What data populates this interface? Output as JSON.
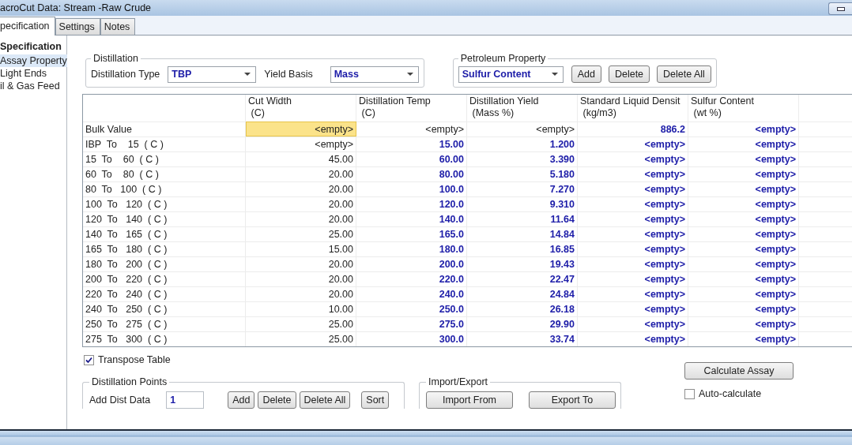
{
  "window": {
    "title": "acroCut Data: Stream -Raw Crude"
  },
  "tabs": [
    {
      "label": "pecification",
      "selected": true
    },
    {
      "label": "Settings",
      "selected": false
    },
    {
      "label": "Notes",
      "selected": false
    }
  ],
  "sidebar": {
    "heading": "Specification",
    "items": [
      {
        "label": "Assay Property",
        "selected": true
      },
      {
        "label": "Light Ends",
        "selected": false
      },
      {
        "label": "il & Gas Feed",
        "selected": false
      }
    ]
  },
  "distillation": {
    "title": "Distillation",
    "type_label": "Distillation Type",
    "type_value": "TBP",
    "basis_label": "Yield Basis",
    "basis_value": "Mass"
  },
  "petroleum_property": {
    "title": "Petroleum Property",
    "value": "Sulfur Content",
    "buttons": [
      "Add",
      "Delete",
      "Delete All"
    ]
  },
  "table": {
    "columns": [
      {
        "name": "Cut Width",
        "unit": "(C)"
      },
      {
        "name": "Distillation Temp",
        "unit": "(C)"
      },
      {
        "name": "Distillation Yield",
        "unit": "(Mass %)"
      },
      {
        "name": "Standard Liquid Densit",
        "unit": "(kg/m3)"
      },
      {
        "name": "Sulfur Content",
        "unit": "(wt %)"
      }
    ],
    "rows": [
      {
        "label": "Bulk Value",
        "cells": [
          {
            "text": "<empty>",
            "bold": false,
            "selected": true
          },
          {
            "text": "<empty>",
            "bold": false,
            "selected": false
          },
          {
            "text": "<empty>",
            "bold": false,
            "selected": false
          },
          {
            "text": "886.2",
            "bold": true,
            "selected": false
          },
          {
            "text": "<empty>",
            "bold": true,
            "selected": false
          }
        ]
      },
      {
        "label": "IBP  To    15  ( C )",
        "cells": [
          {
            "text": "<empty>",
            "bold": false,
            "selected": false
          },
          {
            "text": "15.00",
            "bold": true,
            "selected": false
          },
          {
            "text": "1.200",
            "bold": true,
            "selected": false
          },
          {
            "text": "<empty>",
            "bold": true,
            "selected": false
          },
          {
            "text": "<empty>",
            "bold": true,
            "selected": false
          }
        ]
      },
      {
        "label": "15  To    60  ( C )",
        "cells": [
          {
            "text": "45.00",
            "bold": false,
            "selected": false
          },
          {
            "text": "60.00",
            "bold": true,
            "selected": false
          },
          {
            "text": "3.390",
            "bold": true,
            "selected": false
          },
          {
            "text": "<empty>",
            "bold": true,
            "selected": false
          },
          {
            "text": "<empty>",
            "bold": true,
            "selected": false
          }
        ]
      },
      {
        "label": "60  To    80  ( C )",
        "cells": [
          {
            "text": "20.00",
            "bold": false,
            "selected": false
          },
          {
            "text": "80.00",
            "bold": true,
            "selected": false
          },
          {
            "text": "5.180",
            "bold": true,
            "selected": false
          },
          {
            "text": "<empty>",
            "bold": true,
            "selected": false
          },
          {
            "text": "<empty>",
            "bold": true,
            "selected": false
          }
        ]
      },
      {
        "label": "80  To   100  ( C )",
        "cells": [
          {
            "text": "20.00",
            "bold": false,
            "selected": false
          },
          {
            "text": "100.0",
            "bold": true,
            "selected": false
          },
          {
            "text": "7.270",
            "bold": true,
            "selected": false
          },
          {
            "text": "<empty>",
            "bold": true,
            "selected": false
          },
          {
            "text": "<empty>",
            "bold": true,
            "selected": false
          }
        ]
      },
      {
        "label": "100  To   120  ( C )",
        "cells": [
          {
            "text": "20.00",
            "bold": false,
            "selected": false
          },
          {
            "text": "120.0",
            "bold": true,
            "selected": false
          },
          {
            "text": "9.310",
            "bold": true,
            "selected": false
          },
          {
            "text": "<empty>",
            "bold": true,
            "selected": false
          },
          {
            "text": "<empty>",
            "bold": true,
            "selected": false
          }
        ]
      },
      {
        "label": "120  To   140  ( C )",
        "cells": [
          {
            "text": "20.00",
            "bold": false,
            "selected": false
          },
          {
            "text": "140.0",
            "bold": true,
            "selected": false
          },
          {
            "text": "11.64",
            "bold": true,
            "selected": false
          },
          {
            "text": "<empty>",
            "bold": true,
            "selected": false
          },
          {
            "text": "<empty>",
            "bold": true,
            "selected": false
          }
        ]
      },
      {
        "label": "140  To   165  ( C )",
        "cells": [
          {
            "text": "25.00",
            "bold": false,
            "selected": false
          },
          {
            "text": "165.0",
            "bold": true,
            "selected": false
          },
          {
            "text": "14.84",
            "bold": true,
            "selected": false
          },
          {
            "text": "<empty>",
            "bold": true,
            "selected": false
          },
          {
            "text": "<empty>",
            "bold": true,
            "selected": false
          }
        ]
      },
      {
        "label": "165  To   180  ( C )",
        "cells": [
          {
            "text": "15.00",
            "bold": false,
            "selected": false
          },
          {
            "text": "180.0",
            "bold": true,
            "selected": false
          },
          {
            "text": "16.85",
            "bold": true,
            "selected": false
          },
          {
            "text": "<empty>",
            "bold": true,
            "selected": false
          },
          {
            "text": "<empty>",
            "bold": true,
            "selected": false
          }
        ]
      },
      {
        "label": "180  To   200  ( C )",
        "cells": [
          {
            "text": "20.00",
            "bold": false,
            "selected": false
          },
          {
            "text": "200.0",
            "bold": true,
            "selected": false
          },
          {
            "text": "19.43",
            "bold": true,
            "selected": false
          },
          {
            "text": "<empty>",
            "bold": true,
            "selected": false
          },
          {
            "text": "<empty>",
            "bold": true,
            "selected": false
          }
        ]
      },
      {
        "label": "200  To   220  ( C )",
        "cells": [
          {
            "text": "20.00",
            "bold": false,
            "selected": false
          },
          {
            "text": "220.0",
            "bold": true,
            "selected": false
          },
          {
            "text": "22.47",
            "bold": true,
            "selected": false
          },
          {
            "text": "<empty>",
            "bold": true,
            "selected": false
          },
          {
            "text": "<empty>",
            "bold": true,
            "selected": false
          }
        ]
      },
      {
        "label": "220  To   240  ( C )",
        "cells": [
          {
            "text": "20.00",
            "bold": false,
            "selected": false
          },
          {
            "text": "240.0",
            "bold": true,
            "selected": false
          },
          {
            "text": "24.84",
            "bold": true,
            "selected": false
          },
          {
            "text": "<empty>",
            "bold": true,
            "selected": false
          },
          {
            "text": "<empty>",
            "bold": true,
            "selected": false
          }
        ]
      },
      {
        "label": "240  To   250  ( C )",
        "cells": [
          {
            "text": "10.00",
            "bold": false,
            "selected": false
          },
          {
            "text": "250.0",
            "bold": true,
            "selected": false
          },
          {
            "text": "26.18",
            "bold": true,
            "selected": false
          },
          {
            "text": "<empty>",
            "bold": true,
            "selected": false
          },
          {
            "text": "<empty>",
            "bold": true,
            "selected": false
          }
        ]
      },
      {
        "label": "250  To   275  ( C )",
        "cells": [
          {
            "text": "25.00",
            "bold": false,
            "selected": false
          },
          {
            "text": "275.0",
            "bold": true,
            "selected": false
          },
          {
            "text": "29.90",
            "bold": true,
            "selected": false
          },
          {
            "text": "<empty>",
            "bold": true,
            "selected": false
          },
          {
            "text": "<empty>",
            "bold": true,
            "selected": false
          }
        ]
      },
      {
        "label": "275  To   300  ( C )",
        "cells": [
          {
            "text": "25.00",
            "bold": false,
            "selected": false
          },
          {
            "text": "300.0",
            "bold": true,
            "selected": false
          },
          {
            "text": "33.74",
            "bold": true,
            "selected": false
          },
          {
            "text": "<empty>",
            "bold": true,
            "selected": false
          },
          {
            "text": "<empty>",
            "bold": true,
            "selected": false
          }
        ]
      }
    ]
  },
  "transpose": {
    "label": "Transpose Table",
    "checked": true
  },
  "distillation_points": {
    "title": "Distillation Points",
    "label": "Add Dist Data",
    "value": "1",
    "buttons": [
      "Add",
      "Delete",
      "Delete All",
      "Sort"
    ]
  },
  "import_export": {
    "title": "Import/Export",
    "buttons": [
      "Import From",
      "Export To"
    ]
  },
  "calculate": {
    "label": "Calculate Assay"
  },
  "auto_calculate": {
    "label": "Auto-calculate",
    "checked": false
  }
}
